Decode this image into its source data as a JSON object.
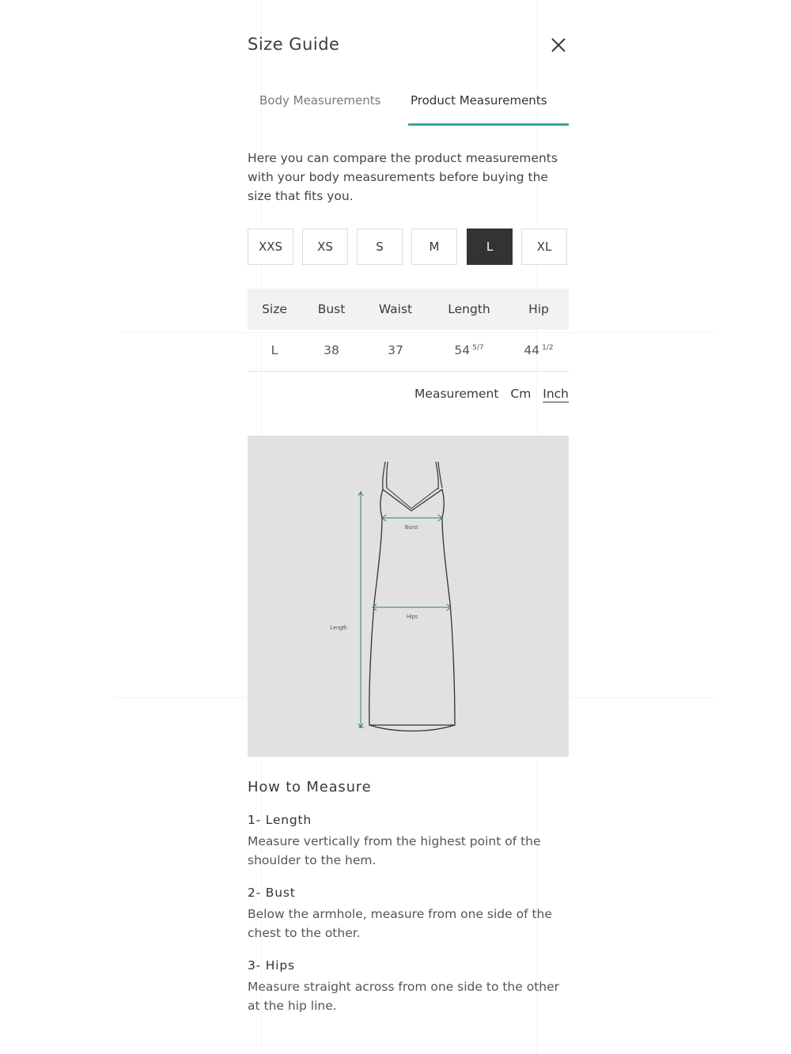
{
  "modal": {
    "title": "Size Guide",
    "close_icon": "close-icon"
  },
  "tabs": [
    {
      "label": "Body Measurements",
      "active": false
    },
    {
      "label": "Product Measurements",
      "active": true
    }
  ],
  "intro_text": "Here you can compare the product measurements with your body measurements before buying the size that fits you.",
  "sizes": [
    {
      "label": "XXS",
      "selected": false
    },
    {
      "label": "XS",
      "selected": false
    },
    {
      "label": "S",
      "selected": false
    },
    {
      "label": "M",
      "selected": false
    },
    {
      "label": "L",
      "selected": true
    },
    {
      "label": "XL",
      "selected": false
    }
  ],
  "table": {
    "headers": [
      "Size",
      "Bust",
      "Waist",
      "Length",
      "Hip"
    ],
    "row": {
      "size": "L",
      "bust": "38",
      "waist": "37",
      "length": "54",
      "length_fraction": "5/7",
      "hip": "44",
      "hip_fraction": "1/2"
    }
  },
  "units": {
    "label": "Measurement",
    "cm": "Cm",
    "inch": "Inch",
    "selected": "Inch"
  },
  "diagram": {
    "labels": {
      "bust": "Burst",
      "hips": "Hips",
      "length": "Length"
    },
    "accent_color": "#3a7a5c",
    "background": "#e1e1e1"
  },
  "how_to_measure": {
    "title": "How to Measure",
    "steps": [
      {
        "title": "1- Length",
        "text": "Measure vertically from the highest point of the shoulder to the hem."
      },
      {
        "title": "2- Bust",
        "text": "Below the armhole, measure from one side of the chest to the other."
      },
      {
        "title": "3- Hips",
        "text": "Measure straight across from one side to the other at the hip line."
      }
    ]
  },
  "colors": {
    "tab_underline": "#3aa595",
    "selected_size_bg": "#333333",
    "table_header_bg": "#f2f2f2"
  }
}
